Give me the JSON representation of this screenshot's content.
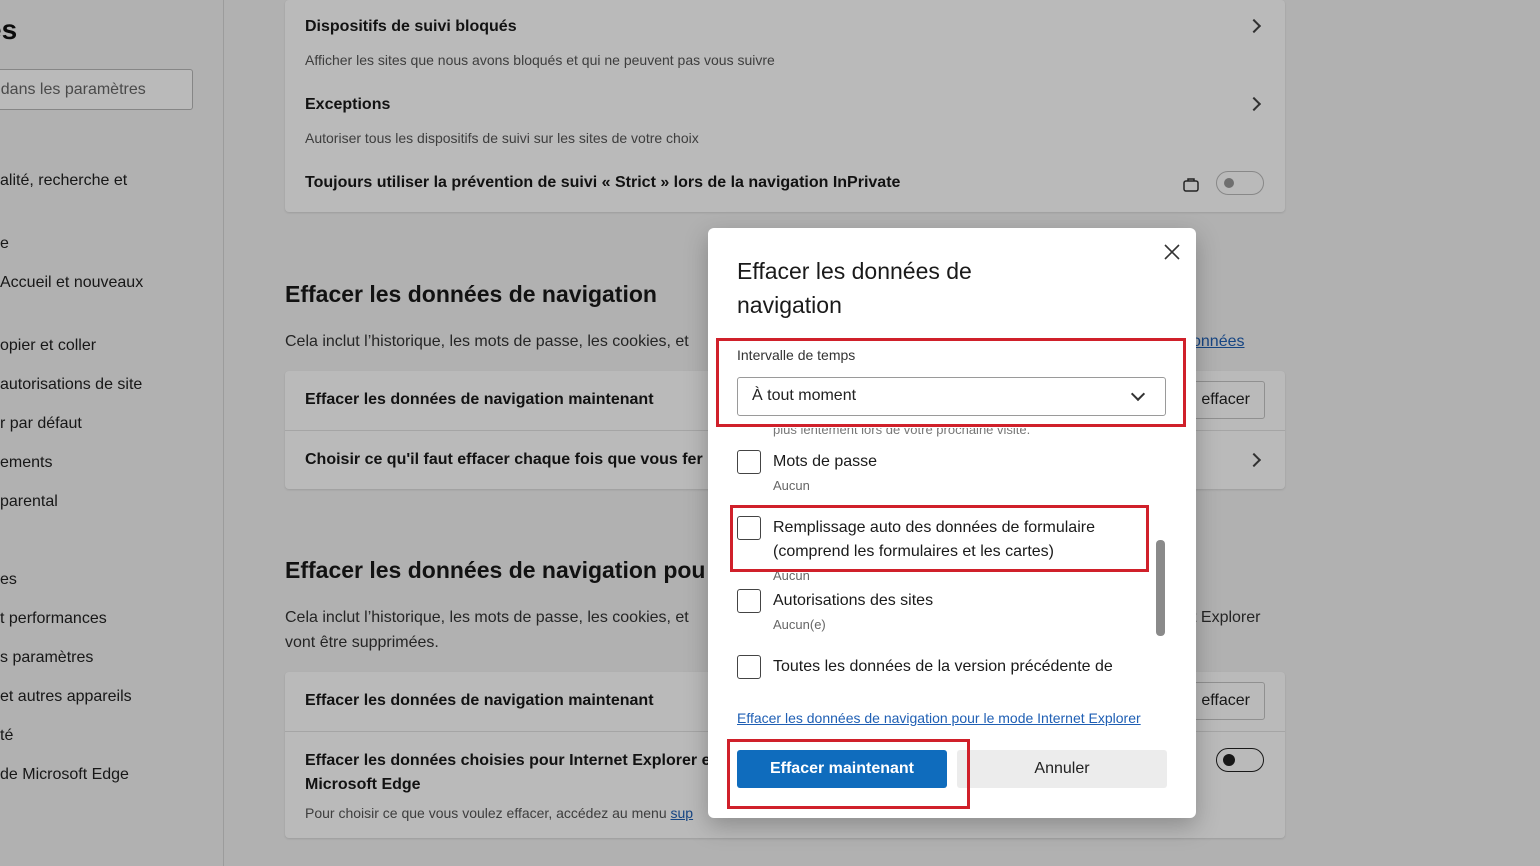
{
  "sidebar": {
    "title": "es",
    "search_placeholder": "r dans les paramètres",
    "items": [
      "alité, recherche et",
      "e",
      " Accueil et nouveaux",
      "opier et coller",
      " autorisations de site",
      "r par défaut",
      "ements",
      "parental",
      "es",
      "t performances",
      "s paramètres",
      " et autres appareils",
      "té",
      "de Microsoft Edge"
    ]
  },
  "tracking_card": {
    "blocked_title": "Dispositifs de suivi bloqués",
    "blocked_desc": "Afficher les sites que nous avons bloqués et qui ne peuvent pas vous suivre",
    "exceptions_title": "Exceptions",
    "exceptions_desc": "Autoriser tous les dispositifs de suivi sur les sites de votre choix",
    "strict_title": "Toujours utiliser la prévention de suivi « Strict » lors de la navigation InPrivate"
  },
  "section1": {
    "title": "Effacer les données de navigation",
    "desc": "Cela inclut l’historique, les mots de passe, les cookies, et",
    "link_tail": "onnées",
    "row1_title": "Effacer les données de navigation maintenant",
    "row1_button": " effacer",
    "row2_title": "Choisir ce qu'il faut effacer chaque fois que vous fer"
  },
  "section2": {
    "title": "Effacer les données de navigation pou",
    "desc_line1": "Cela inclut l’historique, les mots de passe, les cookies, et",
    "desc_line1_tail": "t Explorer",
    "desc_line2": "vont être supprimées.",
    "row1_title": "Effacer les données de navigation maintenant",
    "row1_button": " effacer",
    "row2_title_line1": "Effacer les données choisies pour Internet Explorer e",
    "row2_title_line2": "Microsoft Edge",
    "row2_desc": "Pour choisir ce que vous voulez effacer, accédez au menu",
    "row2_link": "sup"
  },
  "dialog": {
    "title": "Effacer les données de navigation",
    "range_label": "Intervalle de temps",
    "range_value": "À tout moment",
    "partial_text": "plus lentement lors de votre prochaine visite.",
    "options": [
      {
        "label": "Mots de passe",
        "sub": "Aucun",
        "checked": false
      },
      {
        "label": "Remplissage auto des données de formulaire",
        "label2": "(comprend les formulaires et les cartes)",
        "sub": "Aucun",
        "checked": false
      },
      {
        "label": "Autorisations des sites",
        "sub": "Aucun(e)",
        "checked": false
      },
      {
        "label": "Toutes les données de la version précédente de",
        "sub": "",
        "checked": false
      }
    ],
    "ie_link": "Effacer les données de navigation pour le mode Internet Explorer",
    "clear_button": "Effacer maintenant",
    "cancel_button": "Annuler"
  },
  "colors": {
    "primary": "#0f6cbd",
    "highlight": "#d0202a",
    "link": "#1f5fb4"
  }
}
